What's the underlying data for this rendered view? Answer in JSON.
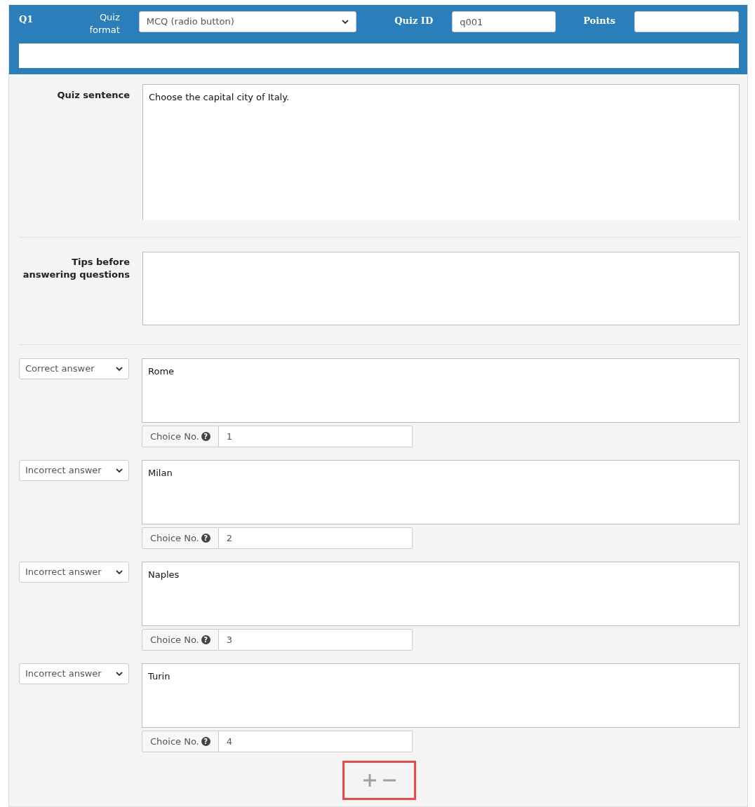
{
  "question": {
    "number": "Q1",
    "format_label": "Quiz format",
    "format": "MCQ (radio button)",
    "id_label": "Quiz ID",
    "id": "q001",
    "points_label": "Points"
  },
  "sentence": {
    "label": "Quiz sentence",
    "value": "Choose the capital city of Italy."
  },
  "tips": {
    "label": "Tips before answering questions"
  },
  "choices": [
    {
      "answer_type": "Correct answer",
      "text": "Rome",
      "number_label": "Choice No.",
      "help": "?",
      "number": "1"
    },
    {
      "answer_type": "Incorrect answer",
      "text": "Milan",
      "number_label": "Choice No.",
      "help": "?",
      "number": "2"
    },
    {
      "answer_type": "Incorrect answer",
      "text": "Naples",
      "number_label": "Choice No.",
      "help": "?",
      "number": "3"
    },
    {
      "answer_type": "Incorrect answer",
      "text": "Turin",
      "number_label": "Choice No.",
      "help": "?",
      "number": "4"
    }
  ]
}
